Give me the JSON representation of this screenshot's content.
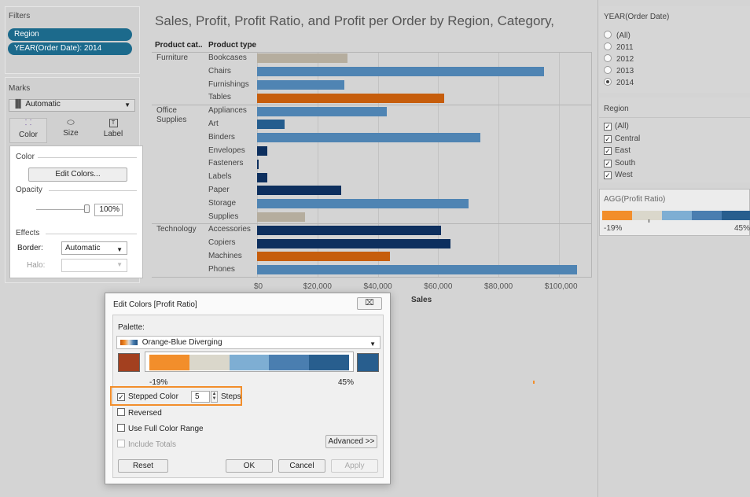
{
  "filters": {
    "title": "Filters",
    "pills": [
      "Region",
      "YEAR(Order Date): 2014"
    ]
  },
  "marks": {
    "title": "Marks",
    "mark_type": "Automatic",
    "buttons": [
      "Color",
      "Size",
      "Label"
    ]
  },
  "color_popup": {
    "color_heading": "Color",
    "edit_colors_label": "Edit Colors...",
    "opacity_heading": "Opacity",
    "opacity_value": "100%",
    "opacity_fraction": 1.0,
    "effects_heading": "Effects",
    "border_label": "Border:",
    "border_value": "Automatic",
    "halo_label": "Halo:"
  },
  "chart": {
    "title": "Sales, Profit, Profit Ratio, and Profit per Order by Region, Category,",
    "col_header_category": "Product cat..",
    "col_header_type": "Product type",
    "xlabel": "Sales"
  },
  "chart_data": {
    "type": "bar",
    "orientation": "horizontal",
    "title": "Sales, Profit, Profit Ratio, and Profit per Order by Region, Category,",
    "xlabel": "Sales",
    "xlim": [
      0,
      110000
    ],
    "x_ticks": [
      "$0",
      "$20,000",
      "$40,000",
      "$60,000",
      "$80,000",
      "$100,000"
    ],
    "tick_values": [
      0,
      20000,
      40000,
      60000,
      80000,
      100000
    ],
    "grid": true,
    "groups": [
      {
        "category": "Furniture",
        "rows": [
          {
            "type": "Bookcases",
            "value": 30000,
            "color": "#b5ad9e"
          },
          {
            "type": "Chairs",
            "value": 95000,
            "color": "#4f84b3"
          },
          {
            "type": "Furnishings",
            "value": 29000,
            "color": "#4f84b3"
          },
          {
            "type": "Tables",
            "value": 62000,
            "color": "#c65d0c"
          }
        ]
      },
      {
        "category": "Office\nSupplies",
        "rows": [
          {
            "type": "Appliances",
            "value": 43000,
            "color": "#4f84b3"
          },
          {
            "type": "Art",
            "value": 9000,
            "color": "#245d8e"
          },
          {
            "type": "Binders",
            "value": 74000,
            "color": "#4f84b3"
          },
          {
            "type": "Envelopes",
            "value": 3500,
            "color": "#0d2f5e"
          },
          {
            "type": "Fasteners",
            "value": 500,
            "color": "#0d2f5e"
          },
          {
            "type": "Labels",
            "value": 3500,
            "color": "#0d2f5e"
          },
          {
            "type": "Paper",
            "value": 28000,
            "color": "#0d2f5e"
          },
          {
            "type": "Storage",
            "value": 70000,
            "color": "#4f84b3"
          },
          {
            "type": "Supplies",
            "value": 16000,
            "color": "#b5ad9e"
          }
        ]
      },
      {
        "category": "Technology",
        "rows": [
          {
            "type": "Accessories",
            "value": 61000,
            "color": "#0d2f5e"
          },
          {
            "type": "Copiers",
            "value": 64000,
            "color": "#0d2f5e"
          },
          {
            "type": "Machines",
            "value": 44000,
            "color": "#c65d0c"
          },
          {
            "type": "Phones",
            "value": 106000,
            "color": "#4f84b3"
          }
        ]
      }
    ]
  },
  "year_filter": {
    "title": "YEAR(Order Date)",
    "options": [
      "(All)",
      "2011",
      "2012",
      "2013",
      "2014"
    ],
    "selected": "2014"
  },
  "region_filter": {
    "title": "Region",
    "options": [
      "(All)",
      "Central",
      "East",
      "South",
      "West"
    ]
  },
  "legend": {
    "title": "AGG(Profit Ratio)",
    "min_label": "-19%",
    "max_label": "45%",
    "colors": [
      "#f28e2b",
      "#dad7cb",
      "#7eaed3",
      "#4a7eb0",
      "#285e8e"
    ]
  },
  "dialog": {
    "title": "Edit Colors [Profit Ratio]",
    "close_glyph": "⌧",
    "palette_label": "Palette:",
    "palette_value": "Orange-Blue Diverging",
    "min_label": "-19%",
    "max_label": "45%",
    "start_color": "#a3401f",
    "end_color": "#285e8e",
    "steps_colors": [
      "#f28e2b",
      "#dad7cb",
      "#7eaed3",
      "#4a7eb0",
      "#285e8e"
    ],
    "stepped_label": "Stepped Color",
    "steps_value": "5",
    "steps_label": "Steps",
    "reversed_label": "Reversed",
    "full_range_label": "Use Full Color Range",
    "include_totals_label": "Include Totals",
    "advanced_label": "Advanced >>",
    "reset_label": "Reset",
    "ok_label": "OK",
    "cancel_label": "Cancel",
    "apply_label": "Apply",
    "highlight_color": "#f28e2b"
  }
}
